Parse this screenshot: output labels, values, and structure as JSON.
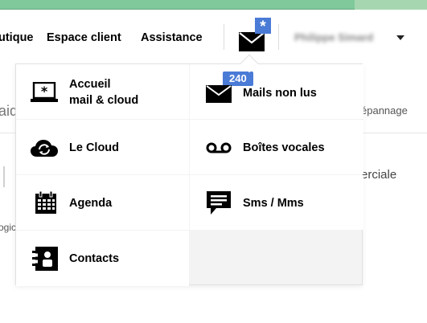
{
  "nav": {
    "links": [
      "utique",
      "Espace client",
      "Assistance"
    ],
    "mail_star": "*",
    "user_name": "Philippe Simard"
  },
  "background": {
    "left_fragment": "aid",
    "depannage": "épannage",
    "commerciale": "erciale",
    "logic": "ogic"
  },
  "menu": {
    "accueil_line1": "Accueil",
    "accueil_line2": "mail & cloud",
    "mails_label": "Mails non lus",
    "mails_badge": "240",
    "cloud_label": "Le Cloud",
    "voc_label": "Boîtes vocales",
    "agenda_label": "Agenda",
    "sms_label": "Sms / Mms",
    "contacts_label": "Contacts"
  },
  "colors": {
    "accent": "#4a7bd6",
    "top_strip": "#7fc99a"
  }
}
